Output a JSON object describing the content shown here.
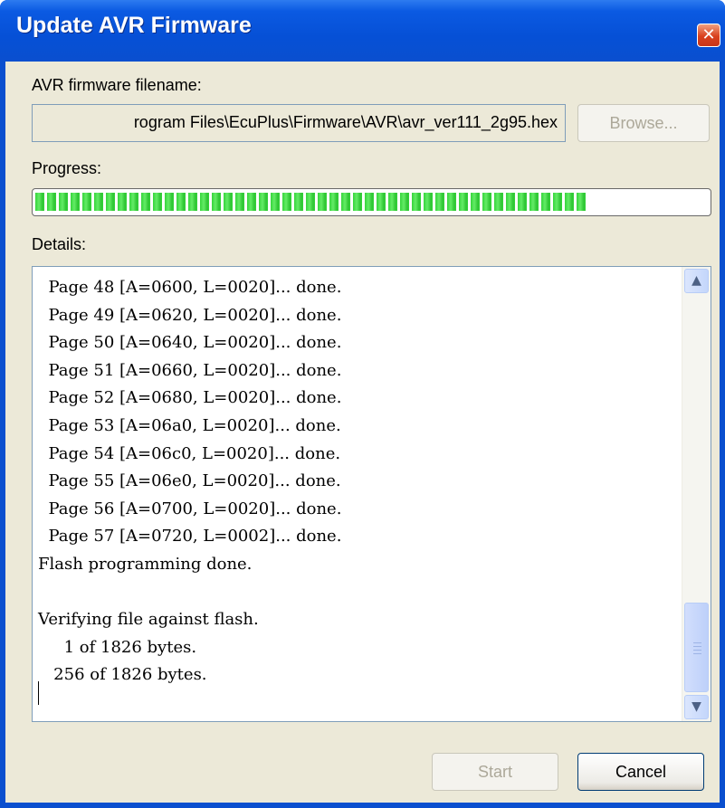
{
  "window": {
    "title": "Update AVR Firmware",
    "close_symbol": "✕"
  },
  "firmware": {
    "label": "AVR firmware filename:",
    "filename": "rogram Files\\EcuPlus\\Firmware\\AVR\\avr_ver111_2g95.hex",
    "browse_label": "Browse..."
  },
  "progress": {
    "label": "Progress:",
    "fraction": 0.82
  },
  "details": {
    "label": "Details:",
    "lines": [
      "  Page 48 [A=0600, L=0020]... done.",
      "  Page 49 [A=0620, L=0020]... done.",
      "  Page 50 [A=0640, L=0020]... done.",
      "  Page 51 [A=0660, L=0020]... done.",
      "  Page 52 [A=0680, L=0020]... done.",
      "  Page 53 [A=06a0, L=0020]... done.",
      "  Page 54 [A=06c0, L=0020]... done.",
      "  Page 55 [A=06e0, L=0020]... done.",
      "  Page 56 [A=0700, L=0020]... done.",
      "  Page 57 [A=0720, L=0002]... done.",
      "Flash programming done.",
      "",
      "Verifying file against flash.",
      "     1 of 1826 bytes.",
      "   256 of 1826 bytes."
    ],
    "scroll_up_icon": "▲",
    "scroll_down_icon": "▼"
  },
  "buttons": {
    "start_label": "Start",
    "cancel_label": "Cancel"
  },
  "colors": {
    "titlebar": "#0a53d8",
    "progress_green": "#35d43b",
    "dialog_bg": "#ece9d8"
  }
}
